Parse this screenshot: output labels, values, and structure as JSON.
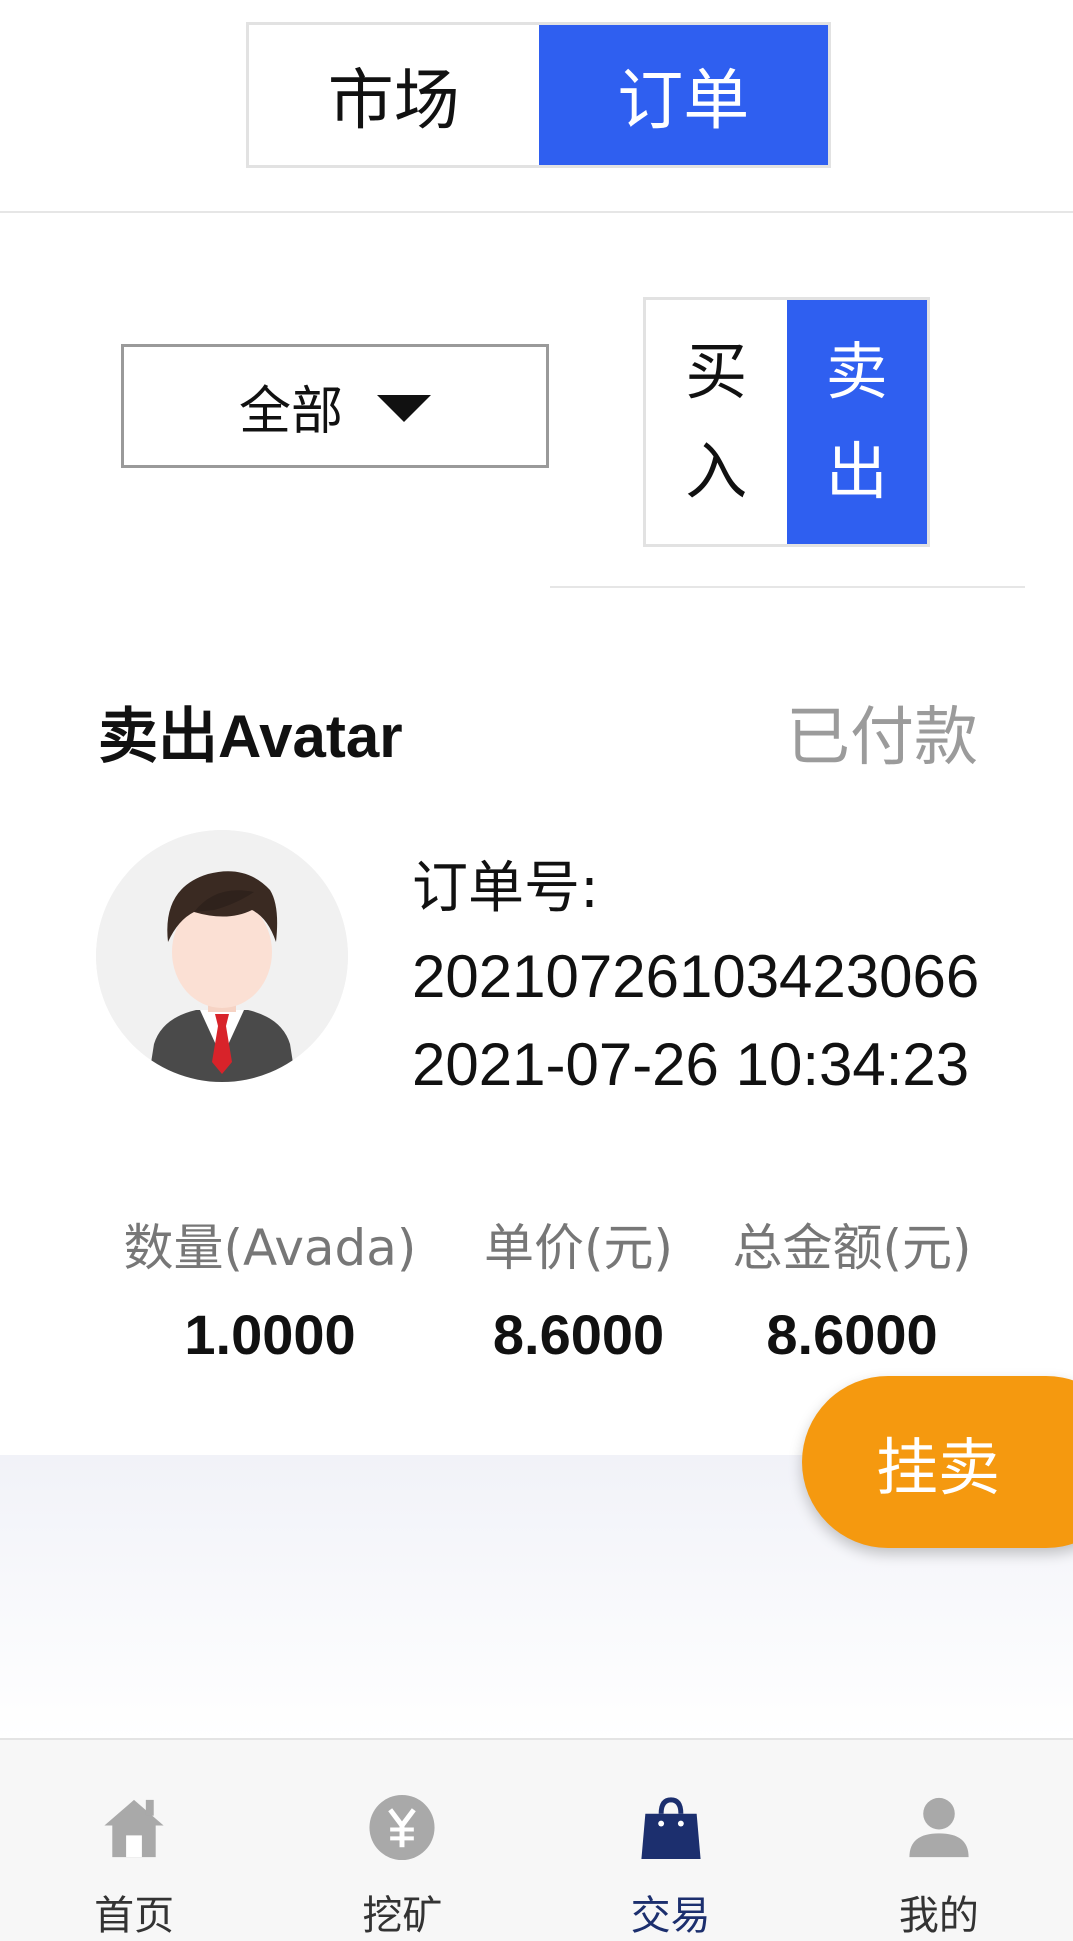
{
  "top_tabs": [
    {
      "label": "市场",
      "active": false
    },
    {
      "label": "订单",
      "active": true
    }
  ],
  "filter": {
    "selected": "全部",
    "icon": "caret-down-icon"
  },
  "side_toggle": [
    {
      "label": "买入",
      "active": false
    },
    {
      "label": "卖出",
      "active": true
    }
  ],
  "order": {
    "title": "卖出Avatar",
    "status": "已付款",
    "avatar_icon": "user-avatar-icon",
    "order_no_label": "订单号:",
    "order_no": "20210726103423066",
    "datetime": "2021-07-26 10:34:23",
    "stats": [
      {
        "label": "数量(Avada)",
        "value": "1.0000"
      },
      {
        "label": "单价(元)",
        "value": "8.6000"
      },
      {
        "label": "总金额(元)",
        "value": "8.6000"
      }
    ]
  },
  "fab": {
    "label": "挂卖"
  },
  "bottom_nav": [
    {
      "label": "首页",
      "icon": "home-icon",
      "active": false
    },
    {
      "label": "挖矿",
      "icon": "yuan-coin-icon",
      "active": false
    },
    {
      "label": "交易",
      "icon": "shopping-bag-icon",
      "active": true
    },
    {
      "label": "我的",
      "icon": "user-icon",
      "active": false
    }
  ],
  "colors": {
    "primary_blue": "#2f5ff0",
    "fab_orange": "#f5990f",
    "status_gray": "#9b9b9b",
    "nav_active": "#1c2f6e",
    "nav_inactive_icon": "#a9a9a9"
  }
}
